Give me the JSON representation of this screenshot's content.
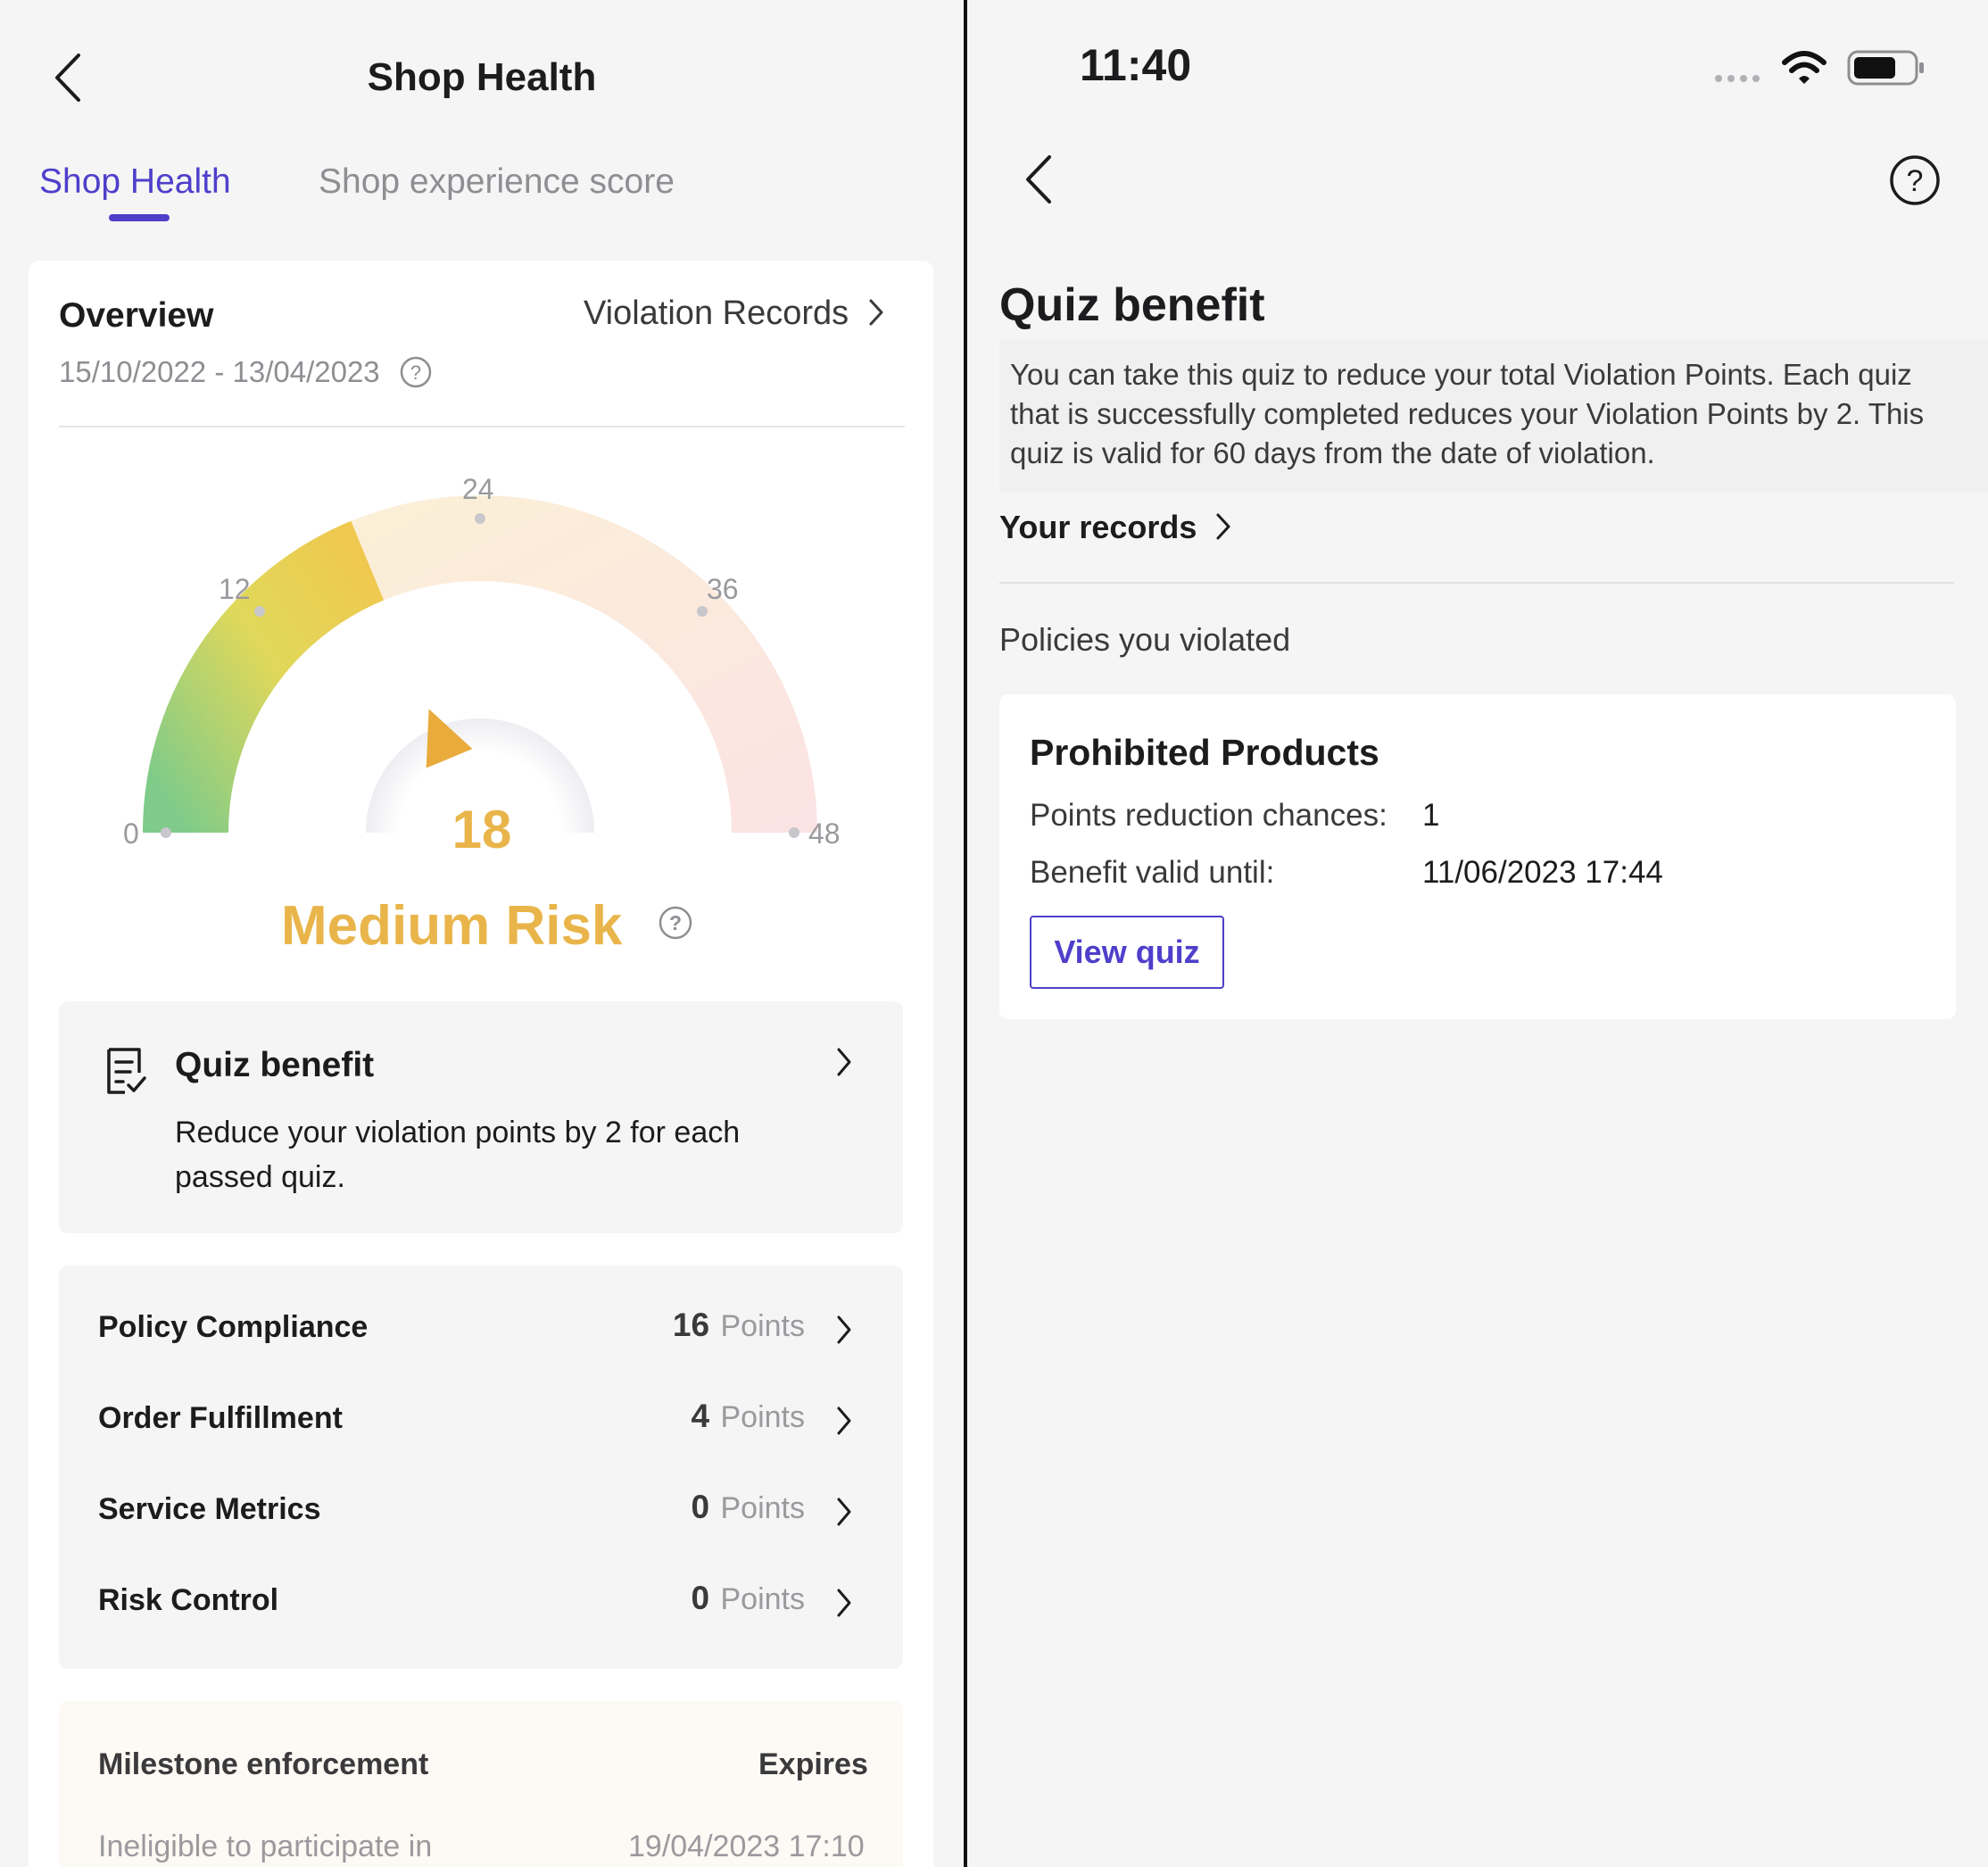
{
  "left": {
    "header": {
      "title": "Shop Health"
    },
    "tabs": [
      {
        "label": "Shop Health",
        "active": true
      },
      {
        "label": "Shop experience score",
        "active": false
      }
    ],
    "overview": {
      "title": "Overview",
      "violation_link": "Violation Records",
      "date_range": "15/10/2022 - 13/04/2023"
    },
    "gauge": {
      "ticks": [
        "0",
        "12",
        "24",
        "36",
        "48"
      ],
      "score": "18",
      "risk_label": "Medium Risk",
      "min": 0,
      "max": 48,
      "value": 18
    },
    "quiz": {
      "title": "Quiz benefit",
      "description": "Reduce your violation points by 2 for each passed quiz."
    },
    "metrics": [
      {
        "name": "Policy Compliance",
        "value": "16",
        "unit": "Points"
      },
      {
        "name": "Order Fulfillment",
        "value": "4",
        "unit": "Points"
      },
      {
        "name": "Service Metrics",
        "value": "0",
        "unit": "Points"
      },
      {
        "name": "Risk Control",
        "value": "0",
        "unit": "Points"
      }
    ],
    "milestone": {
      "title": "Milestone enforcement",
      "expires_label": "Expires",
      "description": "Ineligible to participate in",
      "date": "19/04/2023 17:10"
    }
  },
  "right": {
    "status_bar": {
      "time": "11:40"
    },
    "title": "Quiz benefit",
    "description": "You can take this quiz to reduce your total Violation Points. Each quiz that is successfully completed reduces your Violation Points by 2. This quiz is valid for 60 days from the date of violation.",
    "your_records": "Your records",
    "policies_label": "Policies you violated",
    "policy_card": {
      "title": "Prohibited Products",
      "chances_label": "Points reduction chances:",
      "chances_value": "1",
      "valid_label": "Benefit valid until:",
      "valid_value": "11/06/2023 17:44",
      "button_label": "View quiz"
    }
  },
  "colors": {
    "accent": "#4f3fcb",
    "risk": "#e9b54a"
  },
  "icons": [
    "back-chevron-icon",
    "chevron-right-icon",
    "question-circle-icon",
    "quiz-document-icon",
    "wifi-icon",
    "battery-icon",
    "signal-dots-icon"
  ]
}
